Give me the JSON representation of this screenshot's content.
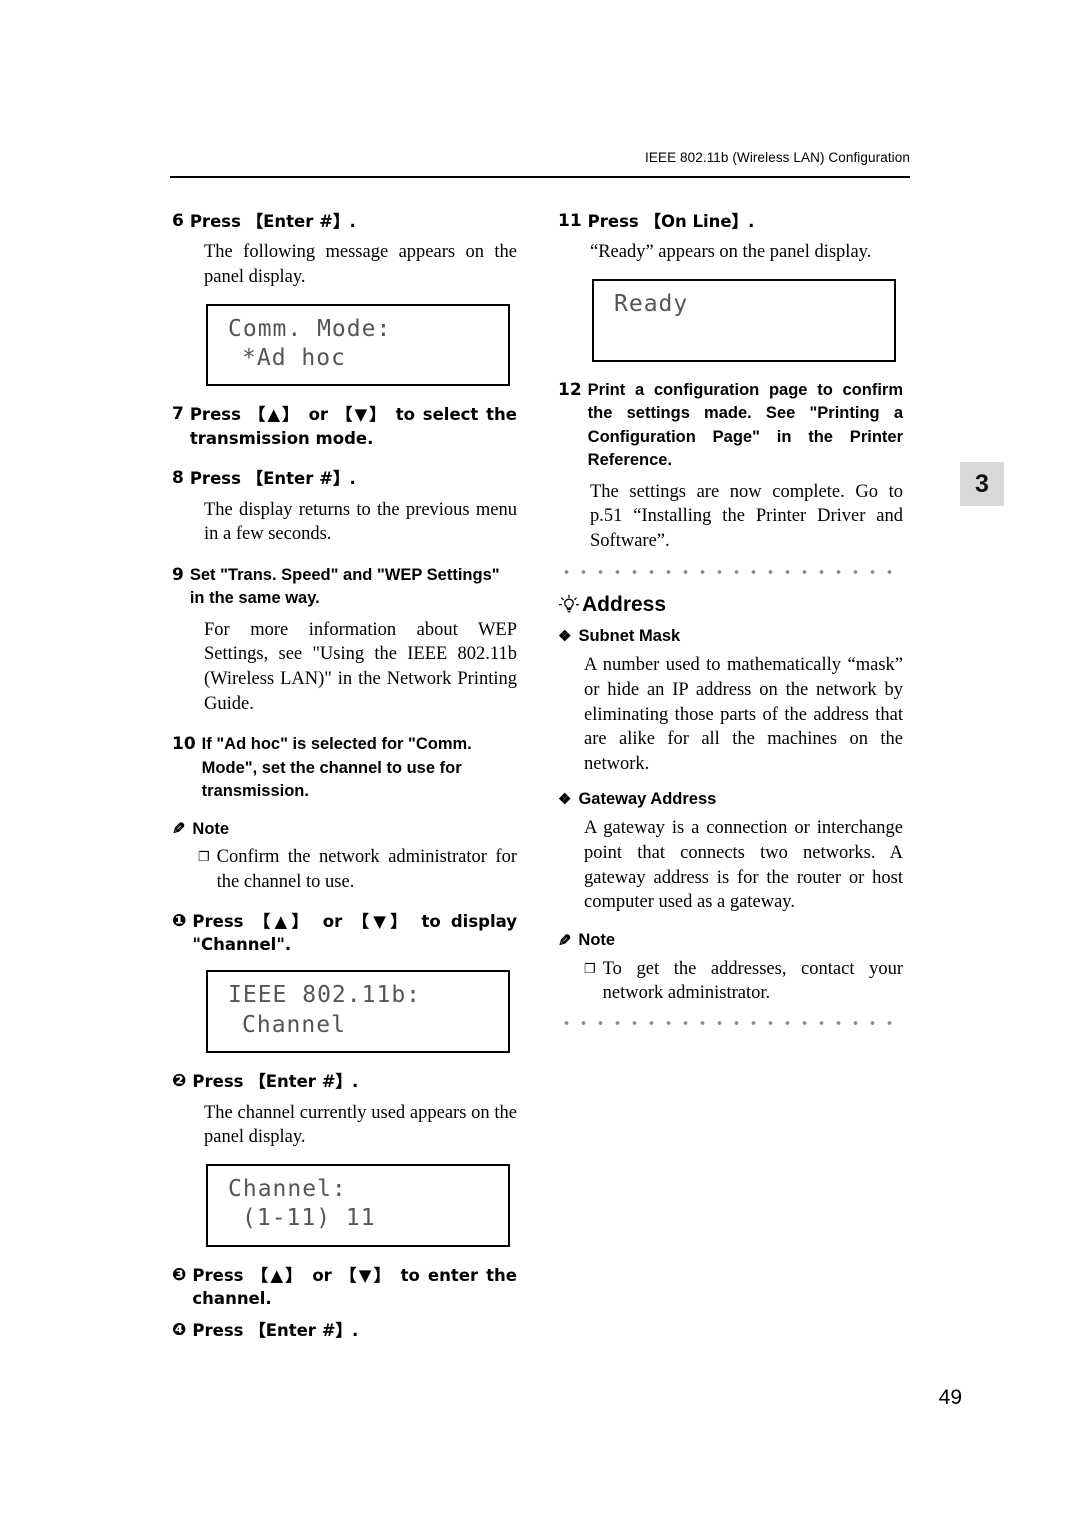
{
  "header": {
    "running_head": "IEEE 802.11b (Wireless LAN) Configuration"
  },
  "chapter_tab": "3",
  "page_number": "49",
  "left_column": {
    "steps": [
      {
        "num": "6",
        "text": "Press 【Enter #】.",
        "body": "The following message appears on the panel display.",
        "lcd": {
          "line1": "Comm. Mode:",
          "line2": "*Ad hoc"
        }
      },
      {
        "num": "7",
        "text": "Press 【▲】 or 【▼】 to select the transmission mode."
      },
      {
        "num": "8",
        "text": "Press 【Enter #】.",
        "body": "The display returns to the previous menu in a few seconds."
      },
      {
        "num": "9",
        "text": "Set \"Trans. Speed\" and \"WEP Settings\" in the same way.",
        "body": "For more information about WEP Settings, see \"Using the IEEE 802.11b (Wireless LAN)\" in the Network Printing Guide."
      },
      {
        "num": "10",
        "text": "If \"Ad hoc\" is selected for \"Comm. Mode\", set the channel to use for transmission."
      }
    ],
    "note": {
      "label": "Note",
      "items": [
        "Confirm the network administrator for the channel to use."
      ]
    },
    "substeps": [
      {
        "num": "❶",
        "text": "Press 【▲】 or 【▼】 to display \"Channel\".",
        "lcd": {
          "line1": "IEEE 802.11b:",
          "line2": "Channel"
        }
      },
      {
        "num": "❷",
        "text": "Press 【Enter #】.",
        "body": "The channel currently used appears on the panel display.",
        "lcd": {
          "line1": "Channel:",
          "line2": "(1-11)    11"
        }
      },
      {
        "num": "❸",
        "text": "Press 【▲】 or 【▼】 to enter the channel."
      },
      {
        "num": "❹",
        "text": "Press 【Enter #】."
      }
    ]
  },
  "right_column": {
    "steps": [
      {
        "num": "11",
        "text": "Press 【On Line】.",
        "body": "“Ready” appears on the panel display.",
        "lcd": {
          "line1": "Ready",
          "line2": ""
        }
      },
      {
        "num": "12",
        "text": "Print a configuration page to confirm the settings made. See \"Printing a Configuration Page\" in the Printer Reference.",
        "body": "The settings are now complete. Go to p.51 “Installing the Printer Driver and Software”."
      }
    ],
    "address_section": {
      "title": "Address",
      "subsections": [
        {
          "heading": "Subnet Mask",
          "body": "A number used to mathematically “mask” or hide an IP address on the network by eliminating those parts of the address that are alike for all the machines on the network."
        },
        {
          "heading": "Gateway Address",
          "body": "A gateway is a connection or interchange point that connects two networks. A gateway address is for the router or host computer used as a gateway."
        }
      ],
      "note": {
        "label": "Note",
        "items": [
          "To get the addresses, contact your network administrator."
        ]
      }
    }
  }
}
